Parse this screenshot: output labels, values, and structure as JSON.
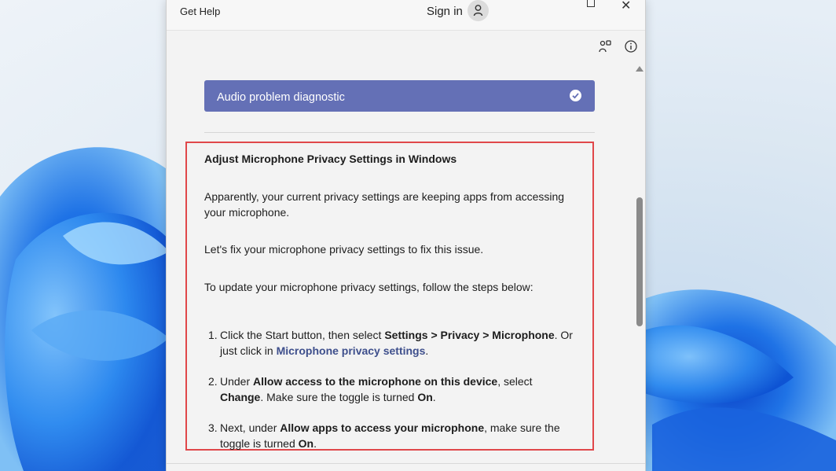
{
  "window": {
    "app_title": "Get Help",
    "sign_in": "Sign in",
    "maximize_label": "",
    "close_label": "✕"
  },
  "header_icons": [
    "share-icon",
    "info-icon"
  ],
  "diagnostic": {
    "label": "Audio problem diagnostic",
    "status": "completed"
  },
  "article": {
    "heading": "Adjust Microphone Privacy Settings in Windows",
    "para1": "Apparently, your current privacy settings are keeping apps from accessing your microphone.",
    "para2": "Let's fix your microphone privacy settings to fix this issue.",
    "para3": "To update your microphone privacy settings, follow the steps below:",
    "steps": [
      {
        "num": "1.",
        "t1": "Click the Start button, then select ",
        "b1": "Settings > Privacy > Microphone",
        "t2": ". Or just click in ",
        "link": "Microphone privacy settings",
        "t3": "."
      },
      {
        "num": "2.",
        "t1": "Under ",
        "b1": "Allow access to the microphone on this device",
        "t2": ", select ",
        "b2": "Change",
        "t3": ". Make sure the toggle is turned ",
        "b3": "On",
        "t4": "."
      },
      {
        "num": "3.",
        "t1": "Next, under ",
        "b1": "Allow apps to access your microphone",
        "t2": ", make sure the toggle is turned ",
        "b2": "On",
        "t3": "."
      }
    ]
  },
  "colors": {
    "accent": "#6470b6",
    "highlight_border": "#e0474a",
    "link": "#3e4f8c",
    "wallpaper_blue": "#1f73e6"
  }
}
